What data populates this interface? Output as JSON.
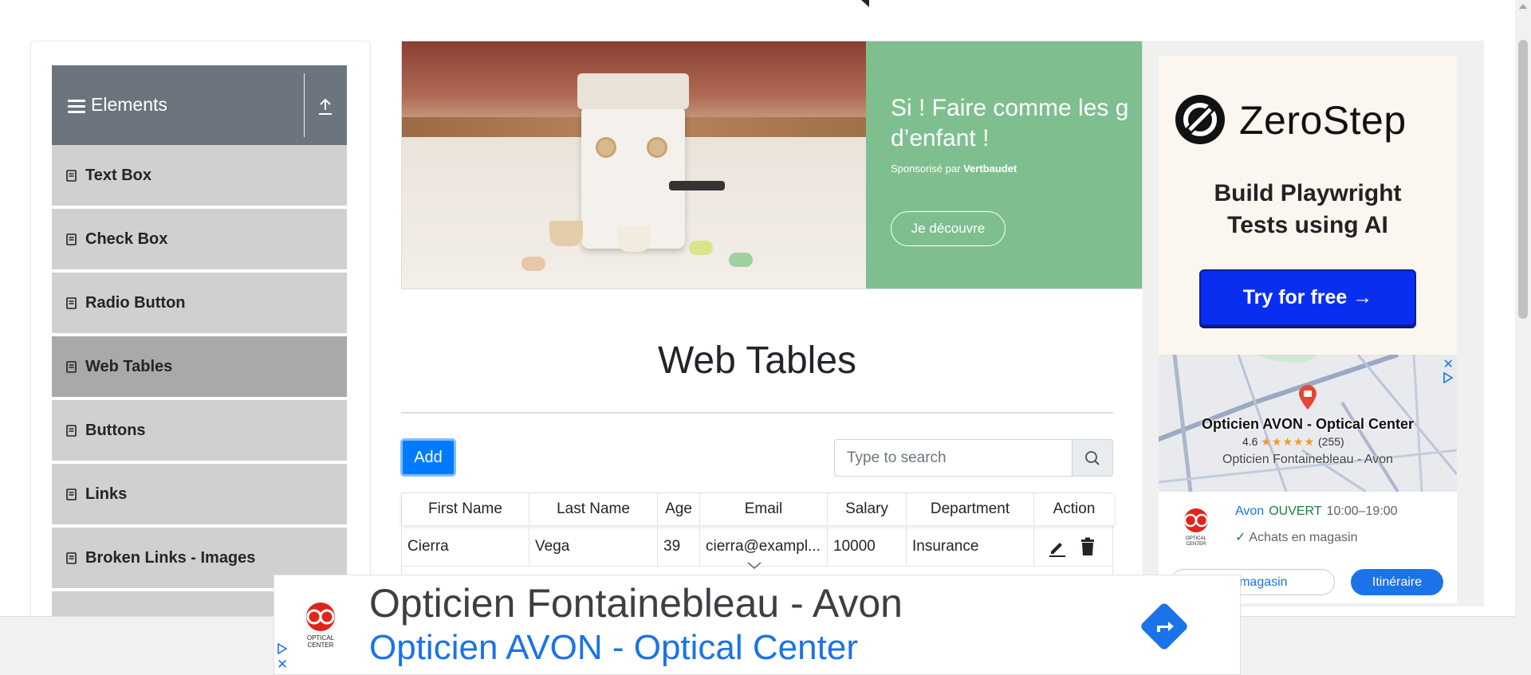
{
  "sidebar": {
    "group_title": "Elements",
    "items": [
      {
        "label": "Text Box"
      },
      {
        "label": "Check Box"
      },
      {
        "label": "Radio Button"
      },
      {
        "label": "Web Tables",
        "active": true
      },
      {
        "label": "Buttons"
      },
      {
        "label": "Links"
      },
      {
        "label": "Broken Links - Images"
      }
    ]
  },
  "banner_ad": {
    "headline_line1": "Si ! Faire comme les g",
    "headline_line2": "d’enfant !",
    "sponsor_prefix": "Sponsorisé par",
    "sponsor_name": "Vertbaudet",
    "cta": "Je découvre"
  },
  "main": {
    "title": "Web Tables",
    "add_label": "Add",
    "search_placeholder": "Type to search",
    "columns": [
      "First Name",
      "Last Name",
      "Age",
      "Email",
      "Salary",
      "Department",
      "Action"
    ],
    "rows": [
      {
        "first": "Cierra",
        "last": "Vega",
        "age": "39",
        "email": "cierra@exampl...",
        "salary": "10000",
        "department": "Insurance"
      }
    ]
  },
  "right_ad": {
    "brand": "ZeroStep",
    "tagline_line1": "Build Playwright",
    "tagline_line2": "Tests using AI",
    "cta": "Try for free →"
  },
  "map_ad": {
    "store_name": "Opticien AVON - Optical Center",
    "rating": "4.6",
    "stars": "★★★★★",
    "review_count": "(255)",
    "subtitle": "Opticien Fontainebleau - Avon",
    "brand": "Avon",
    "status": "OUVERT",
    "hours": "10:00–19:00",
    "feature": "Achats en magasin",
    "store_button": "r le magasin",
    "route_button": "Itinéraire",
    "logo_text": "OPTICAL CENTER"
  },
  "bottom_ad": {
    "headline": "Opticien Fontainebleau - Avon",
    "subline": "Opticien AVON - Optical Center",
    "logo_text": "OPTICAL CENTER"
  },
  "colors": {
    "sidebar_header": "#6c757d",
    "menu_item": "#d0d0d0",
    "menu_item_active": "#a9a9a9",
    "primary": "#007bff",
    "ad_green": "#7fbf8f",
    "zerostep_cta": "#0a2ef0",
    "google_blue": "#1a73e8"
  }
}
